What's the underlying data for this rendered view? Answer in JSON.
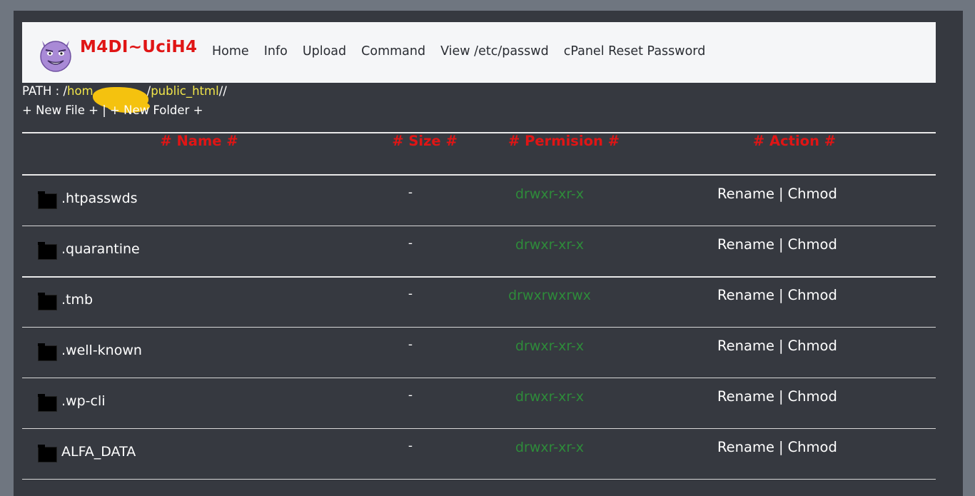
{
  "nav": {
    "brand": "M4DI~UciH4",
    "logo_icon": "purple-devil-emoji-icon",
    "links": [
      "Home",
      "Info",
      "Upload",
      "Command",
      "View /etc/passwd",
      "cPanel Reset Password"
    ]
  },
  "path": {
    "label": "PATH : ",
    "seg1_sep": "/",
    "seg1": "hom",
    "seg2_sep": "/",
    "seg2": "public_html",
    "trail": "//"
  },
  "create": {
    "new_file": "+ New File +",
    "divider": " | ",
    "new_folder": "+ New Folder +"
  },
  "table": {
    "headers": {
      "name": "# Name #",
      "size": "# Size #",
      "permission": "# Permision #",
      "action": "# Action #"
    },
    "rows": [
      {
        "name": ".htpasswds",
        "size": "-",
        "perm": "drwxr-xr-x",
        "rename": "Rename",
        "chmod": "Chmod"
      },
      {
        "name": ".quarantine",
        "size": "-",
        "perm": "drwxr-xr-x",
        "rename": "Rename",
        "chmod": "Chmod"
      },
      {
        "name": ".tmb",
        "size": "-",
        "perm": "drwxrwxrwx",
        "rename": "Rename",
        "chmod": "Chmod"
      },
      {
        "name": ".well-known",
        "size": "-",
        "perm": "drwxr-xr-x",
        "rename": "Rename",
        "chmod": "Chmod"
      },
      {
        "name": ".wp-cli",
        "size": "-",
        "perm": "drwxr-xr-x",
        "rename": "Rename",
        "chmod": "Chmod"
      },
      {
        "name": "ALFA_DATA",
        "size": "-",
        "perm": "drwxr-xr-x",
        "rename": "Rename",
        "chmod": "Chmod"
      }
    ],
    "separator": "|",
    "icon": "folder-icon"
  },
  "colors": {
    "brand": "#e01515",
    "path_highlight": "#f2e64a",
    "permission": "#2e8b3a",
    "panel": "#363940",
    "navbar": "#f5f6f8"
  }
}
